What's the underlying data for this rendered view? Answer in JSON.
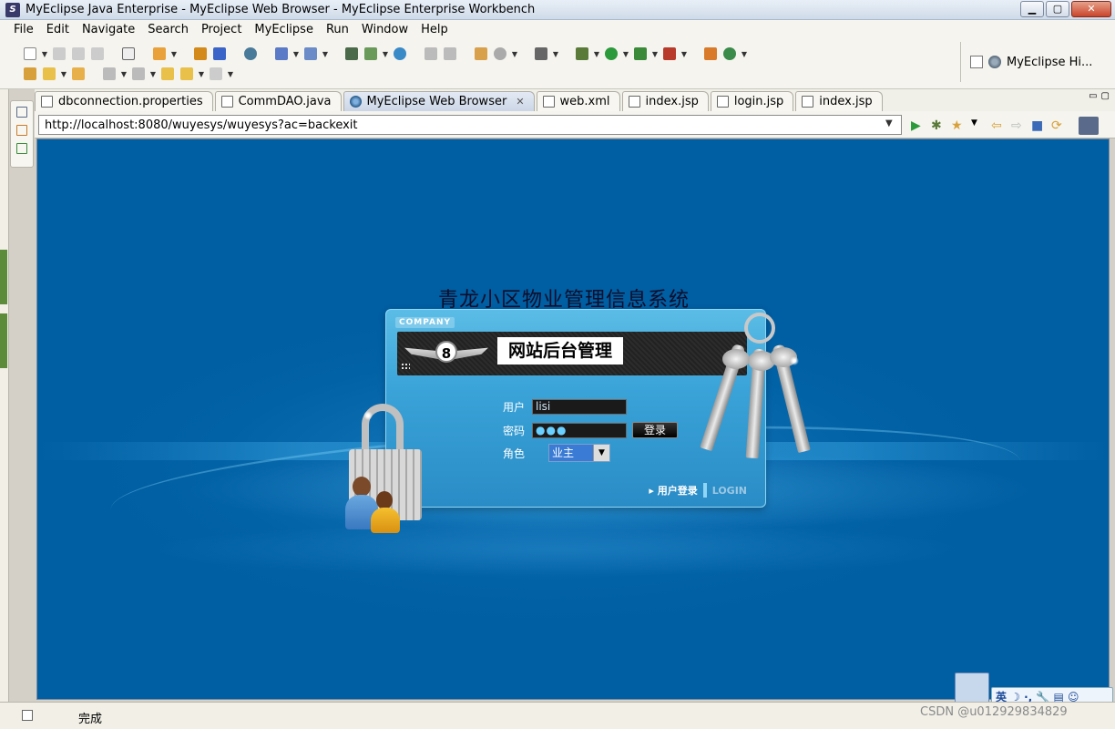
{
  "window": {
    "title": "MyEclipse Java Enterprise - MyEclipse Web Browser - MyEclipse Enterprise Workbench",
    "app_icon": "myeclipse-icon",
    "controls": [
      "minimize",
      "maximize",
      "close"
    ]
  },
  "menubar": [
    "File",
    "Edit",
    "Navigate",
    "Search",
    "Project",
    "MyEclipse",
    "Run",
    "Window",
    "Help"
  ],
  "perspective": {
    "label": "MyEclipse Hi..."
  },
  "tabs": [
    {
      "label": "dbconnection.properties",
      "icon": "properties-file-icon",
      "active": false
    },
    {
      "label": "CommDAO.java",
      "icon": "java-file-icon",
      "active": false
    },
    {
      "label": "MyEclipse Web Browser",
      "icon": "globe-icon",
      "active": true
    },
    {
      "label": "web.xml",
      "icon": "xml-file-icon",
      "active": false
    },
    {
      "label": "index.jsp",
      "icon": "jsp-file-icon",
      "active": false
    },
    {
      "label": "login.jsp",
      "icon": "jsp-file-icon",
      "active": false
    },
    {
      "label": "index.jsp",
      "icon": "jsp-file-icon",
      "active": false
    }
  ],
  "browser": {
    "url": "http://localhost:8080/wuyesys/wuyesys?ac=backexit"
  },
  "page": {
    "system_title": "青龙小区物业管理信息系统",
    "company_tag": "COMPANY",
    "banner_title": "网站后台管理",
    "logo_badge": "8",
    "username_label": "用户",
    "username_value": "lisi",
    "password_label": "密码",
    "password_mask": "●●●",
    "login_button": "登录",
    "role_label": "角色",
    "role_value": "业主",
    "footer_cn": "▸ 用户登录",
    "footer_en": "LOGIN"
  },
  "ime": {
    "text": "英 ☽ ·, 🔧 ▤ ☺"
  },
  "status": {
    "text": "完成",
    "watermark": "CSDN @u012929834829"
  },
  "colors": {
    "page_bg": "#0262a6",
    "panel": "#3aa3d8",
    "title_bar": "#cfdbe9"
  }
}
